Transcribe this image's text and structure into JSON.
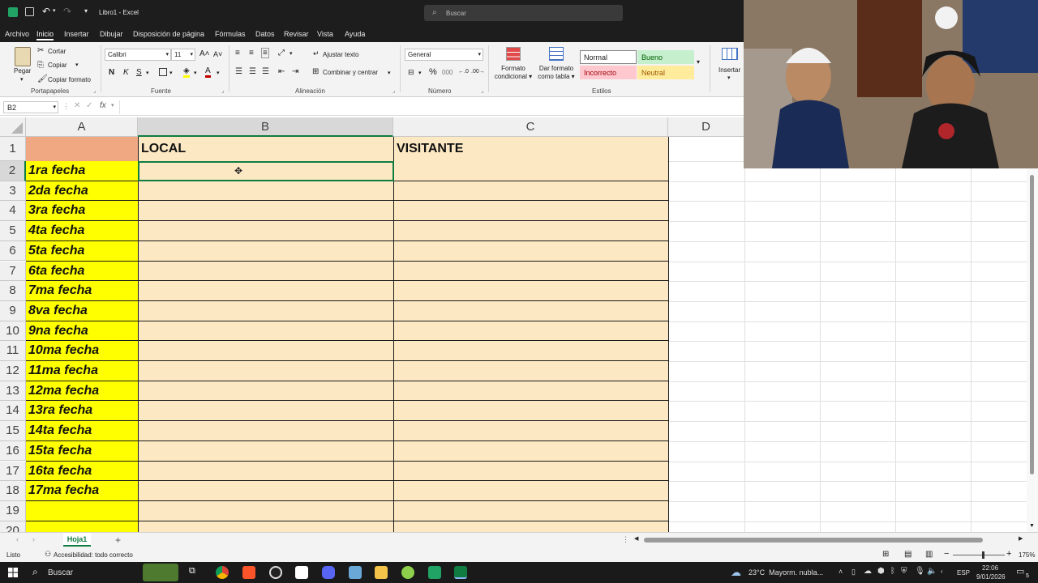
{
  "title": {
    "doc": "Libro1",
    "sep": "-",
    "app": "Excel",
    "search_placeholder": "Buscar"
  },
  "tabs": [
    "Archivo",
    "Inicio",
    "Insertar",
    "Dibujar",
    "Disposición de página",
    "Fórmulas",
    "Datos",
    "Revisar",
    "Vista",
    "Ayuda"
  ],
  "ribbon": {
    "paste": "Pegar",
    "cut": "Cortar",
    "copy": "Copiar",
    "format_painter": "Copiar formato",
    "clipboard_group": "Portapapeles",
    "font_name": "Calibri",
    "font_size": "11",
    "font_group": "Fuente",
    "bold": "N",
    "italic": "K",
    "underline": "S",
    "wrap_text": "Ajustar texto",
    "merge_center": "Combinar y centrar",
    "alignment_group": "Alineación",
    "number_format": "General",
    "number_group": "Número",
    "cond_format_1": "Formato",
    "cond_format_2": "condicional",
    "format_table_1": "Dar formato",
    "format_table_2": "como tabla",
    "styles_group": "Estilos",
    "style_normal": "Normal",
    "style_bueno": "Bueno",
    "style_incorrecto": "Incorrecto",
    "style_neutral": "Neutral",
    "insert": "Insertar"
  },
  "formula_bar": {
    "name_box": "B2",
    "fx": "fx",
    "value": ""
  },
  "columns": [
    "A",
    "B",
    "C",
    "D"
  ],
  "row_numbers": [
    "1",
    "2",
    "3",
    "4",
    "5",
    "6",
    "7",
    "8",
    "9",
    "10",
    "11",
    "12",
    "13",
    "14",
    "15",
    "16",
    "17",
    "18",
    "19",
    "20"
  ],
  "header_row": {
    "a": "",
    "b": "LOCAL",
    "c": "VISITANTE"
  },
  "fechas": [
    "1ra fecha",
    "2da fecha",
    "3ra fecha",
    "4ta fecha",
    "5ta fecha",
    "6ta fecha",
    "7ma fecha",
    "8va fecha",
    "9na fecha",
    "10ma fecha",
    "11ma fecha",
    "12ma fecha",
    "13ra fecha",
    "14ta fecha",
    "15ta fecha",
    "16ta fecha",
    "17ma fecha"
  ],
  "sheets": {
    "active": "Hoja1",
    "add": "+"
  },
  "status": {
    "ready": "Listo",
    "accessibility": "Accesibilidad: todo correcto",
    "zoom": "175%"
  },
  "taskbar": {
    "search": "Buscar",
    "weather": "23°C  Mayorm. nubla...",
    "lang": "ESP",
    "time": "22:06",
    "date": "9/01/2026",
    "notif": "5"
  },
  "colors": {
    "salmon": "#f0a883",
    "yellow": "#ffff00",
    "cream": "#fce9c4",
    "excel_green": "#107c41"
  }
}
